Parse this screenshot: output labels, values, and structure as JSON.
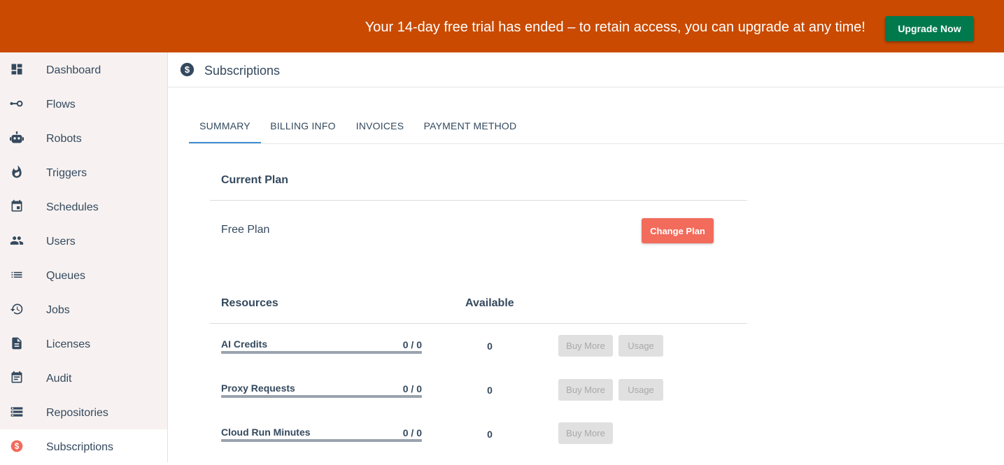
{
  "banner": {
    "message": "Your 14-day free trial has ended – to retain access, you can upgrade at any time!",
    "button_label": "Upgrade Now",
    "color": "#c94a00"
  },
  "sidebar": {
    "items": [
      {
        "label": "Dashboard",
        "icon": "dashboard-icon"
      },
      {
        "label": "Flows",
        "icon": "flow-icon"
      },
      {
        "label": "Robots",
        "icon": "robot-icon"
      },
      {
        "label": "Triggers",
        "icon": "fire-icon"
      },
      {
        "label": "Schedules",
        "icon": "calendar-icon"
      },
      {
        "label": "Users",
        "icon": "users-icon"
      },
      {
        "label": "Queues",
        "icon": "list-icon"
      },
      {
        "label": "Jobs",
        "icon": "history-icon"
      },
      {
        "label": "Licenses",
        "icon": "document-icon"
      },
      {
        "label": "Audit",
        "icon": "event-note-icon"
      },
      {
        "label": "Repositories",
        "icon": "storage-icon"
      },
      {
        "label": "Subscriptions",
        "icon": "dollar-icon",
        "active": true
      }
    ]
  },
  "header": {
    "title": "Subscriptions",
    "icon": "dollar-icon"
  },
  "tabs": [
    {
      "label": "SUMMARY",
      "active": true
    },
    {
      "label": "BILLING INFO"
    },
    {
      "label": "INVOICES"
    },
    {
      "label": "PAYMENT METHOD"
    }
  ],
  "plan": {
    "section_title": "Current Plan",
    "name": "Free Plan",
    "change_label": "Change Plan"
  },
  "resources": {
    "col_resources": "Resources",
    "col_available": "Available",
    "items": [
      {
        "name": "AI Credits",
        "usage": "0 / 0",
        "available": "0",
        "buy_label": "Buy More",
        "usage_label": "Usage",
        "fill": 0
      },
      {
        "name": "Proxy Requests",
        "usage": "0 / 0",
        "available": "0",
        "buy_label": "Buy More",
        "usage_label": "Usage",
        "fill": 0
      },
      {
        "name": "Cloud Run Minutes",
        "usage": "0 / 0",
        "available": "0",
        "buy_label": "Buy More",
        "fill": 0
      }
    ]
  },
  "colors": {
    "accent": "#f26b5b",
    "upgrade": "#007a4d",
    "text": "#34495e",
    "tab_indicator": "#3f8fd2"
  }
}
